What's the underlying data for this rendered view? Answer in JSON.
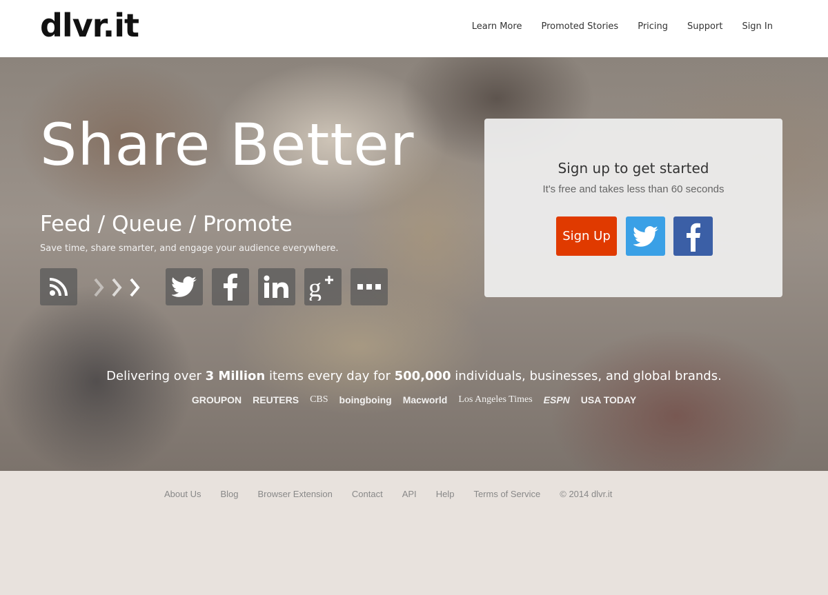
{
  "header": {
    "logo": "dlvr.it",
    "nav": [
      "Learn More",
      "Promoted Stories",
      "Pricing",
      "Support",
      "Sign In"
    ]
  },
  "hero": {
    "title": "Share Better",
    "subtitle": "Feed / Queue / Promote",
    "tagline": "Save time, share smarter, and engage your audience everywhere.",
    "icons": [
      "rss-icon",
      "twitter-icon",
      "facebook-icon",
      "linkedin-icon",
      "google-plus-icon",
      "more-icon"
    ]
  },
  "signup": {
    "title": "Sign up to get started",
    "subtitle": "It's free and takes less than 60 seconds",
    "button_label": "Sign Up"
  },
  "stats": {
    "prefix": "Delivering over ",
    "items_count": "3 Million",
    "middle": " items every day for ",
    "users_count": "500,000",
    "suffix": " individuals, businesses, and global brands."
  },
  "brands": [
    "GROUPON",
    "REUTERS",
    "CBS",
    "boingboing",
    "Macworld",
    "Los Angeles Times",
    "ESPN",
    "USA TODAY"
  ],
  "footer": {
    "links": [
      "About Us",
      "Blog",
      "Browser Extension",
      "Contact",
      "API",
      "Help",
      "Terms of Service"
    ],
    "copyright": "© 2014 dlvr.it"
  },
  "colors": {
    "signup_button": "#e03a00",
    "twitter": "#3aa0e6",
    "facebook": "#3b5fa6"
  }
}
